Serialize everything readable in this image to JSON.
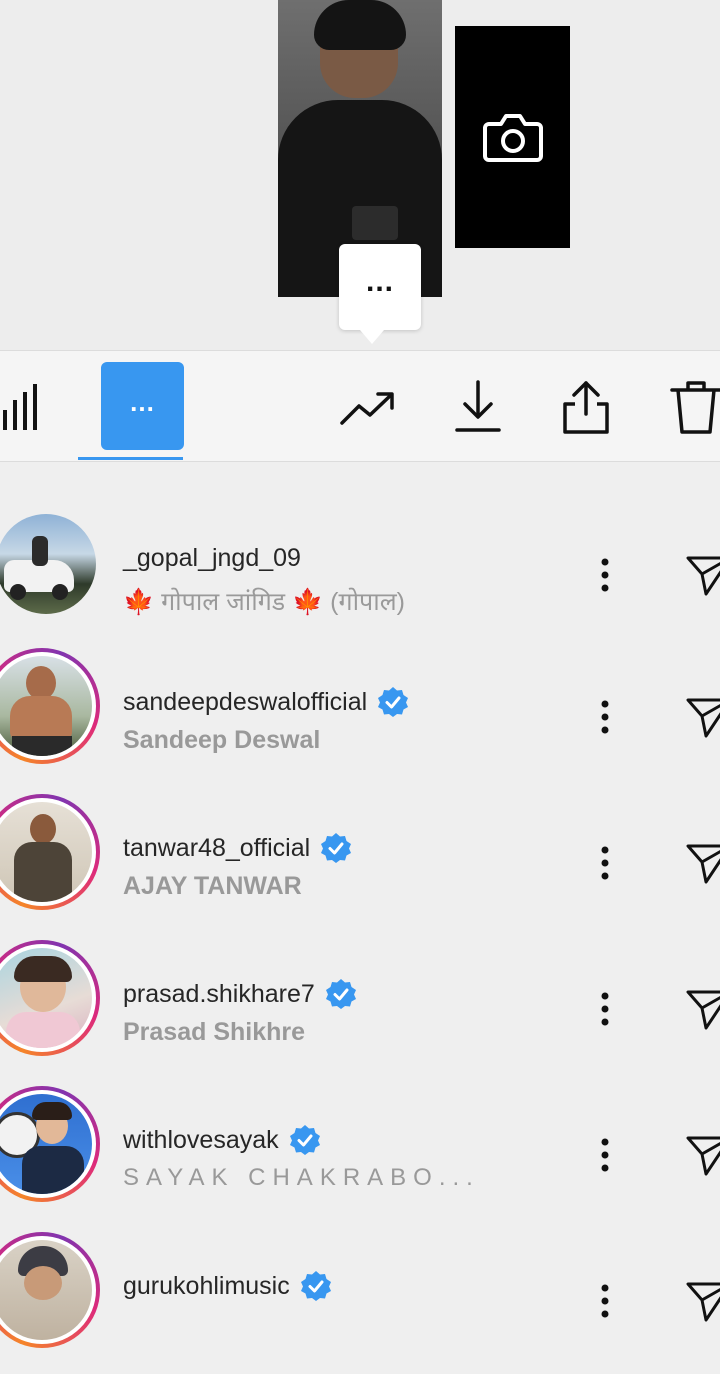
{
  "preview": {
    "more_label": "...",
    "camera_icon": "camera-icon"
  },
  "toolbar": {
    "active_label": "...",
    "icons": [
      "stats-icon",
      "more-icon",
      "trending-icon",
      "download-icon",
      "share-icon",
      "trash-icon"
    ]
  },
  "accounts": [
    {
      "username": "_gopal_jngd_09",
      "fullname": "🍁 गोपाल जांगिड 🍁  (गोपाल)",
      "verified": false,
      "story": false
    },
    {
      "username": "sandeepdeswalofficial",
      "fullname": "Sandeep Deswal",
      "verified": true,
      "story": true
    },
    {
      "username": "tanwar48_official",
      "fullname": "AJAY TANWAR",
      "verified": true,
      "story": true
    },
    {
      "username": "prasad.shikhare7",
      "fullname": "Prasad Shikhre",
      "verified": true,
      "story": true
    },
    {
      "username": "withlovesayak",
      "fullname": "SAYAK CHAKRABO...",
      "verified": true,
      "story": true
    },
    {
      "username": "gurukohlimusic",
      "fullname": "",
      "verified": true,
      "story": true
    }
  ],
  "colors": {
    "accent": "#3897f0",
    "verified": "#3897f0",
    "story_ring": [
      "#f58529",
      "#dd2a7b",
      "#8134af"
    ]
  }
}
